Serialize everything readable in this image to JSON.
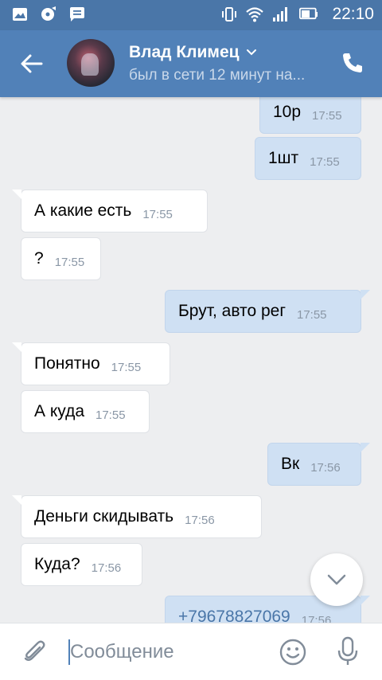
{
  "statusbar": {
    "time": "22:10"
  },
  "header": {
    "name": "Влад Климец",
    "status": "был в сети 12 минут на..."
  },
  "messages": [
    {
      "text": "10р",
      "time": "17:55",
      "dir": "out"
    },
    {
      "text": "1шт",
      "time": "17:55",
      "dir": "out"
    },
    {
      "text": "А какие есть",
      "time": "17:55",
      "dir": "in"
    },
    {
      "text": "?",
      "time": "17:55",
      "dir": "in"
    },
    {
      "text": "Брут, авто рег",
      "time": "17:55",
      "dir": "out"
    },
    {
      "text": "Понятно",
      "time": "17:55",
      "dir": "in"
    },
    {
      "text": "А куда",
      "time": "17:55",
      "dir": "in"
    },
    {
      "text": "Вк",
      "time": "17:56",
      "dir": "out"
    },
    {
      "text": "Деньги скидывать",
      "time": "17:56",
      "dir": "in"
    },
    {
      "text": "Куда?",
      "time": "17:56",
      "dir": "in"
    },
    {
      "text": "+79678827069",
      "time": "17:56",
      "dir": "out"
    }
  ],
  "input": {
    "placeholder": "Сообщение"
  },
  "colors": {
    "header": "#5181b8",
    "statusbar": "#4a76a8",
    "outgoing": "#cfe0f3",
    "incoming": "#ffffff",
    "background": "#edeef0"
  }
}
